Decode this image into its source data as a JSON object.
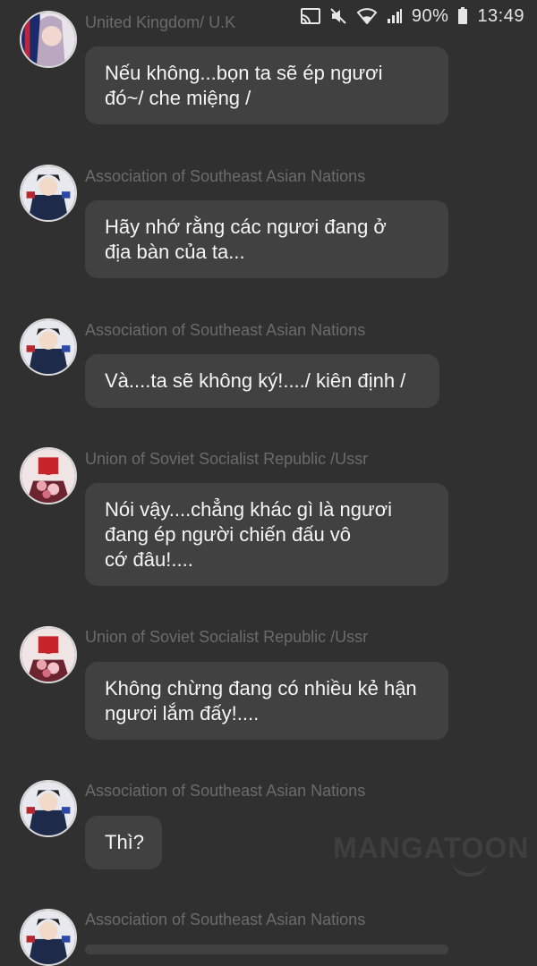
{
  "status_bar": {
    "battery": "90%",
    "time": "13:49",
    "icons": [
      "cast-icon",
      "mute-icon",
      "wifi-icon",
      "signal-icon",
      "battery-icon"
    ]
  },
  "messages": [
    {
      "sender": "United Kingdom/ U.K",
      "avatar": "uk-avatar",
      "text": "Nếu không...bọn ta sẽ ép ngươi\nđó~/ che miệng /"
    },
    {
      "sender": "Association of Southeast Asian Nations",
      "avatar": "asean-avatar",
      "text": "Hãy nhớ rằng các ngươi đang ở\nđịa bàn của ta..."
    },
    {
      "sender": "Association of Southeast Asian Nations",
      "avatar": "asean-avatar",
      "text": "Và....ta sẽ không ký!..../ kiên định /"
    },
    {
      "sender": "Union of Soviet Socialist Republic /Ussr",
      "avatar": "ussr-avatar",
      "text": "Nói vậy....chẳng khác gì là ngươi\nđang ép người chiến đấu vô\ncớ đâu!...."
    },
    {
      "sender": "Union of Soviet Socialist Republic /Ussr",
      "avatar": "ussr-avatar",
      "text": "Không chừng đang có nhiều kẻ hận\nngươi lắm đấy!...."
    },
    {
      "sender": "Association of Southeast Asian Nations",
      "avatar": "asean-avatar",
      "text": "Thì?"
    },
    {
      "sender": "Association of Southeast Asian Nations",
      "avatar": "asean-avatar",
      "text": ""
    }
  ],
  "watermark": "MANGATOON",
  "colors": {
    "background": "#303030",
    "bubble": "#414141",
    "sender_name": "#6b6b6b",
    "message_text": "#f5f5f5"
  }
}
